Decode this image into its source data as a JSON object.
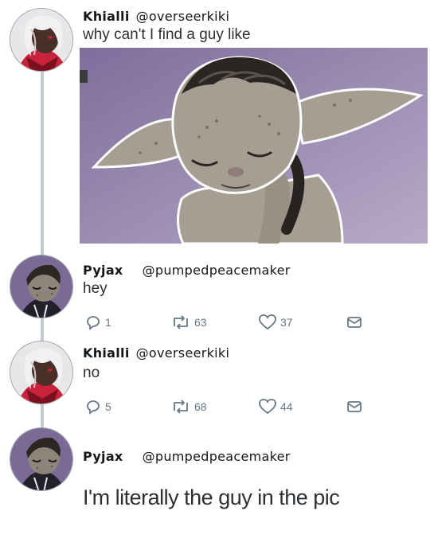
{
  "tweets": [
    {
      "name": "Khialli",
      "handle": "@overseerkiki",
      "text": "why can't I find a guy like"
    },
    {
      "name": "Pyjax",
      "handle": "@pumpedpeacemaker",
      "text": "hey",
      "stats": {
        "replies": "1",
        "retweets": "63",
        "likes": "37"
      }
    },
    {
      "name": "Khialli",
      "handle": "@overseerkiki",
      "text": "no",
      "stats": {
        "replies": "5",
        "retweets": "68",
        "likes": "44"
      }
    },
    {
      "name": "Pyjax",
      "handle": "@pumpedpeacemaker",
      "text": "I'm literally the guy in the pic"
    }
  ],
  "icons": {
    "reply": "reply-icon",
    "retweet": "retweet-icon",
    "like": "heart-icon",
    "message": "envelope-icon"
  },
  "colors": {
    "action_gray": "#657786",
    "thread_line": "#c4cbd1",
    "media_background": "#8a7aa5"
  }
}
